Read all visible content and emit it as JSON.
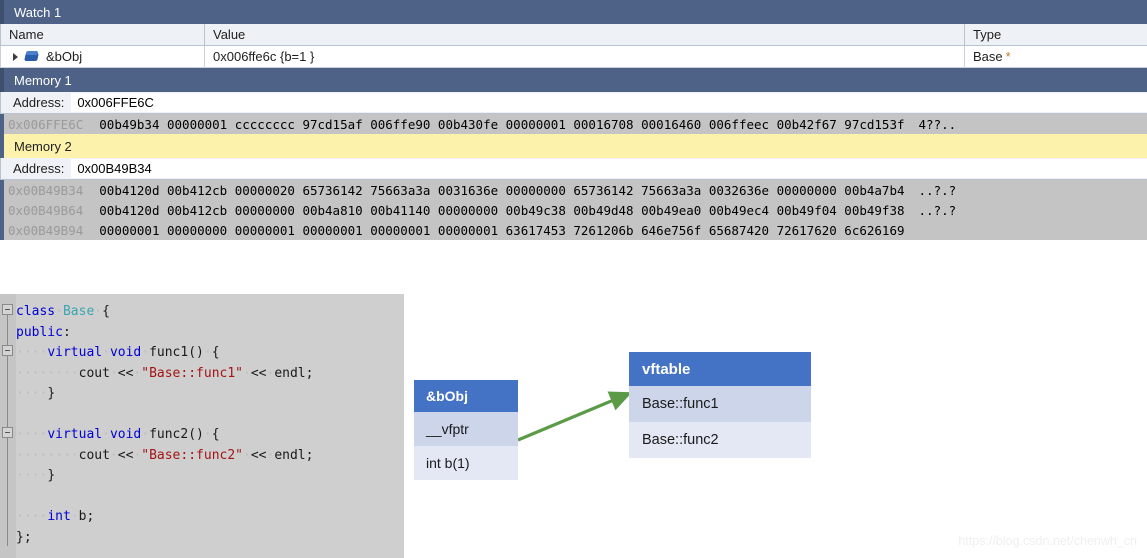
{
  "watch_panel": {
    "title": "Watch 1",
    "columns": [
      "Name",
      "Value",
      "Type"
    ],
    "rows": [
      {
        "name": "&bObj",
        "value": "0x006ffe6c {b=1 }",
        "type": "Base",
        "type_star": "*"
      }
    ]
  },
  "memory1": {
    "title": "Memory 1",
    "address_label": "Address:",
    "address_value": "0x006FFE6C",
    "rows": [
      {
        "addr": "0x006FFE6C",
        "data": "00b49b34 00000001 cccccccc 97cd15af 006ffe90 00b430fe 00000001 00016708 00016460 006ffeec 00b42f67 97cd153f",
        "ascii": "4??.."
      }
    ]
  },
  "memory2": {
    "title": "Memory 2",
    "address_label": "Address:",
    "address_value": "0x00B49B34",
    "rows": [
      {
        "addr": "0x00B49B34",
        "data": "00b4120d 00b412cb 00000020 65736142 75663a3a 0031636e 00000000 65736142 75663a3a 0032636e 00000000 00b4a7b4",
        "ascii": "..?.?"
      },
      {
        "addr": "0x00B49B64",
        "data": "00b4120d 00b412cb 00000000 00b4a810 00b41140 00000000 00b49c38 00b49d48 00b49ea0 00b49ec4 00b49f04 00b49f38",
        "ascii": "..?.?"
      },
      {
        "addr": "0x00B49B94",
        "data": "00000001 00000000 00000001 00000001 00000001 00000001 63617453 7261206b 646e756f 65687420 72617620 6c626169",
        "ascii": ""
      }
    ]
  },
  "code": {
    "lines": [
      [
        {
          "t": "class",
          "c": "k-blue"
        },
        {
          "t": "·",
          "c": "k-dot"
        },
        {
          "t": "Base",
          "c": "k-teal"
        },
        {
          "t": "·",
          "c": "k-dot"
        },
        {
          "t": "{",
          "c": "k-black"
        }
      ],
      [
        {
          "t": "public",
          "c": "k-blue"
        },
        {
          "t": ":",
          "c": "k-black"
        }
      ],
      [
        {
          "t": "····",
          "c": "k-dot"
        },
        {
          "t": "virtual",
          "c": "k-blue"
        },
        {
          "t": "·",
          "c": "k-dot"
        },
        {
          "t": "void",
          "c": "k-blue"
        },
        {
          "t": "·",
          "c": "k-dot"
        },
        {
          "t": "func1()",
          "c": "k-black"
        },
        {
          "t": "·",
          "c": "k-dot"
        },
        {
          "t": "{",
          "c": "k-black"
        }
      ],
      [
        {
          "t": "········",
          "c": "k-dot"
        },
        {
          "t": "cout",
          "c": "k-black"
        },
        {
          "t": "·",
          "c": "k-dot"
        },
        {
          "t": "<<",
          "c": "k-black"
        },
        {
          "t": "·",
          "c": "k-dot"
        },
        {
          "t": "\"Base::func1\"",
          "c": "k-red"
        },
        {
          "t": "·",
          "c": "k-dot"
        },
        {
          "t": "<<",
          "c": "k-black"
        },
        {
          "t": "·",
          "c": "k-dot"
        },
        {
          "t": "endl;",
          "c": "k-black"
        }
      ],
      [
        {
          "t": "····",
          "c": "k-dot"
        },
        {
          "t": "}",
          "c": "k-black"
        }
      ],
      [],
      [
        {
          "t": "····",
          "c": "k-dot"
        },
        {
          "t": "virtual",
          "c": "k-blue"
        },
        {
          "t": "·",
          "c": "k-dot"
        },
        {
          "t": "void",
          "c": "k-blue"
        },
        {
          "t": "·",
          "c": "k-dot"
        },
        {
          "t": "func2()",
          "c": "k-black"
        },
        {
          "t": "·",
          "c": "k-dot"
        },
        {
          "t": "{",
          "c": "k-black"
        }
      ],
      [
        {
          "t": "········",
          "c": "k-dot"
        },
        {
          "t": "cout",
          "c": "k-black"
        },
        {
          "t": "·",
          "c": "k-dot"
        },
        {
          "t": "<<",
          "c": "k-black"
        },
        {
          "t": "·",
          "c": "k-dot"
        },
        {
          "t": "\"Base::func2\"",
          "c": "k-red"
        },
        {
          "t": "·",
          "c": "k-dot"
        },
        {
          "t": "<<",
          "c": "k-black"
        },
        {
          "t": "·",
          "c": "k-dot"
        },
        {
          "t": "endl;",
          "c": "k-black"
        }
      ],
      [
        {
          "t": "····",
          "c": "k-dot"
        },
        {
          "t": "}",
          "c": "k-black"
        }
      ],
      [],
      [
        {
          "t": "····",
          "c": "k-dot"
        },
        {
          "t": "int",
          "c": "k-blue"
        },
        {
          "t": "·",
          "c": "k-dot"
        },
        {
          "t": "b;",
          "c": "k-black"
        }
      ],
      [
        {
          "t": "};",
          "c": "k-black"
        }
      ]
    ]
  },
  "diagram": {
    "object_box": {
      "header": "&bObj",
      "rows": [
        "__vfptr",
        "int b(1)"
      ]
    },
    "vftable_box": {
      "header": "vftable",
      "rows": [
        "Base::func1",
        "Base::func2"
      ]
    },
    "arrow_color": "#5b9b48"
  },
  "watermark": "https://blog.csdn.net/chenwh_cn"
}
